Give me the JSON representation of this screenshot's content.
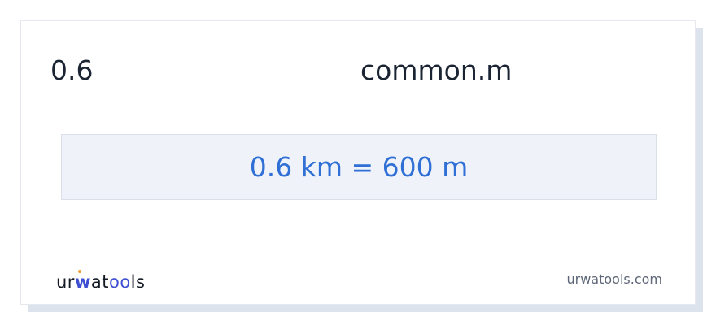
{
  "conversion": {
    "value": "0.6",
    "unit": "common.m",
    "result": "0.6 km = 600 m"
  },
  "branding": {
    "logo_text": "urwatools",
    "logo_part_1": "ur",
    "logo_part_w": "w",
    "logo_part_2": "at",
    "logo_part_oo": "oo",
    "logo_part_3": "ls",
    "site_url": "urwatools.com"
  },
  "colors": {
    "accent": "#2f6fd6",
    "logo_accent": "#3e4fd4",
    "result_background": "#eff3f9",
    "text": "#1b2433"
  }
}
